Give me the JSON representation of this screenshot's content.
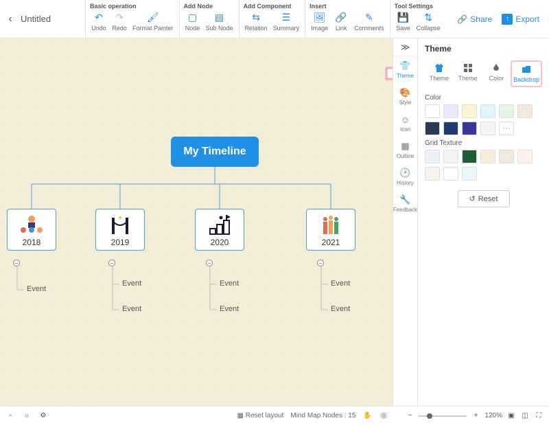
{
  "title": "Untitled",
  "toolbar_groups": {
    "basic": {
      "title": "Basic operation",
      "undo": "Undo",
      "redo": "Redo",
      "format_painter": "Format Painter"
    },
    "add_node": {
      "title": "Add Node",
      "node": "Node",
      "sub_node": "Sub Node"
    },
    "add_component": {
      "title": "Add Component",
      "relation": "Relation",
      "summary": "Summary"
    },
    "insert": {
      "title": "Insert",
      "image": "Image",
      "link": "Link",
      "comments": "Comments"
    },
    "tool_settings": {
      "title": "Tool Settings",
      "save": "Save",
      "collapse": "Collapse"
    }
  },
  "share": "Share",
  "export": "Export",
  "mindmap": {
    "root": "My Timeline",
    "years": [
      {
        "label": "2018",
        "events": [
          "Event"
        ]
      },
      {
        "label": "2019",
        "events": [
          "Event",
          "Event"
        ]
      },
      {
        "label": "2020",
        "events": [
          "Event",
          "Event"
        ]
      },
      {
        "label": "2021",
        "events": [
          "Event",
          "Event"
        ]
      }
    ]
  },
  "rail": {
    "theme": "Theme",
    "style": "Style",
    "icon": "Icon",
    "outline": "Outline",
    "history": "History",
    "feedback": "Feedback"
  },
  "panel": {
    "title": "Theme",
    "tabs": {
      "theme": "Theme",
      "theme2": "Theme",
      "color": "Color",
      "backdrop": "Backdrop"
    },
    "section_color": "Color",
    "section_grid": "Grid Texture",
    "reset": "Reset",
    "colors": [
      "#ffffff",
      "#efe6ff",
      "#fff4cf",
      "#e0f4ff",
      "#e2f5e6",
      "#f4e9da",
      "#2a3a56",
      "#223b70",
      "#3b3699",
      "#f5f5f5"
    ],
    "textures": [
      "#e8f2f8",
      "#f4f4f4",
      "#1e5d34",
      "#f6eedb",
      "#f3e9dd",
      "#fff0ea",
      "#f7f2ea",
      "#ffffff",
      "#e9f7fb"
    ]
  },
  "status": {
    "reset_layout": "Reset layout",
    "nodes_label": "Mind Map Nodes :",
    "nodes_count": "15",
    "zoom": "120%"
  }
}
